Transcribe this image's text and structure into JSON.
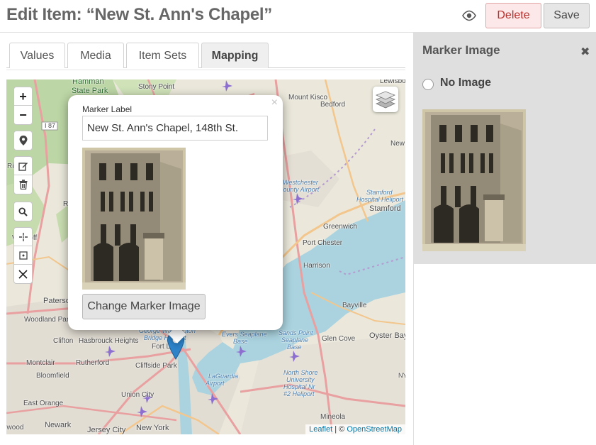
{
  "header": {
    "title": "Edit Item: “New St. Ann's Chapel”",
    "delete_label": "Delete",
    "save_label": "Save",
    "preview_icon": "eye-icon"
  },
  "tabs": [
    {
      "label": "Values",
      "active": false
    },
    {
      "label": "Media",
      "active": false
    },
    {
      "label": "Item Sets",
      "active": false
    },
    {
      "label": "Mapping",
      "active": true
    }
  ],
  "map": {
    "zoom_in_label": "+",
    "zoom_out_label": "−",
    "controls": [
      "marker-icon",
      "edit-icon",
      "trash-icon",
      "search-icon",
      "locate-icon",
      "fit-bounds-icon",
      "clear-icon"
    ],
    "layers_icon": "layers-icon",
    "popup": {
      "label_caption": "Marker Label",
      "label_value": "New St. Ann's Chapel, 148th St.",
      "change_button": "Change Marker Image",
      "close_symbol": "×"
    },
    "attribution": {
      "leaflet": "Leaflet",
      "separator": " | © ",
      "osm": "OpenStreetMap"
    },
    "labels": {
      "hamman": "Hamman",
      "state_park": "State Park",
      "stony_point": "Stony Point",
      "lewisboro": "Lewisboro",
      "bedford": "Bedford",
      "mount_kisco": "Mount Kisco",
      "new_c": "New C",
      "i87": "I 87",
      "westchester": "Westchester",
      "county_airport": "County Airport",
      "stamford_hosp": "Stamford",
      "hospital_heliport": "Hospital Heliport",
      "stamford": "Stamford",
      "greenwich": "Greenwich",
      "port_chester": "Port Chester",
      "harrison": "Harrison",
      "wyckoff": "Wyckoff",
      "paterson": "Paterson",
      "woodland_park": "Woodland Park",
      "clifton": "Clifton",
      "hasbrouck": "Hasbrouck Heights",
      "george_washington": "George Washington",
      "bridge_heliport": "Bridge Heliport",
      "fort_lee": "Fort Lee",
      "cliffside_park": "Cliffside Park",
      "rutherford": "Rutherford",
      "montclair": "Montclair",
      "bloomfield": "Bloomfield",
      "union_city": "Union City",
      "east_orange": "East Orange",
      "newark": "Newark",
      "jersey_city": "Jersey City",
      "new_york": "New York",
      "wood": "ewood",
      "evers": "Evers Seaplane",
      "base": "Base",
      "sands_point": "Sands Point",
      "seaplane": "Seaplane",
      "base2": "Base",
      "bayville": "Bayville",
      "oyster_bay": "Oyster Bay",
      "glen_cove": "Glen Cove",
      "north_shore": "North Shore",
      "university": "University",
      "hospital_nr": "Hospital Nr",
      "heliport2": "#2 Heliport",
      "laguardia": "LaGuardia",
      "airport": "Airport",
      "mineola": "Mineola",
      "ri": "Ri",
      "ra": "Ra",
      "ny": "NY"
    }
  },
  "sidebar": {
    "title": "Marker Image",
    "close_symbol": "✖",
    "no_image_label": "No Image"
  }
}
